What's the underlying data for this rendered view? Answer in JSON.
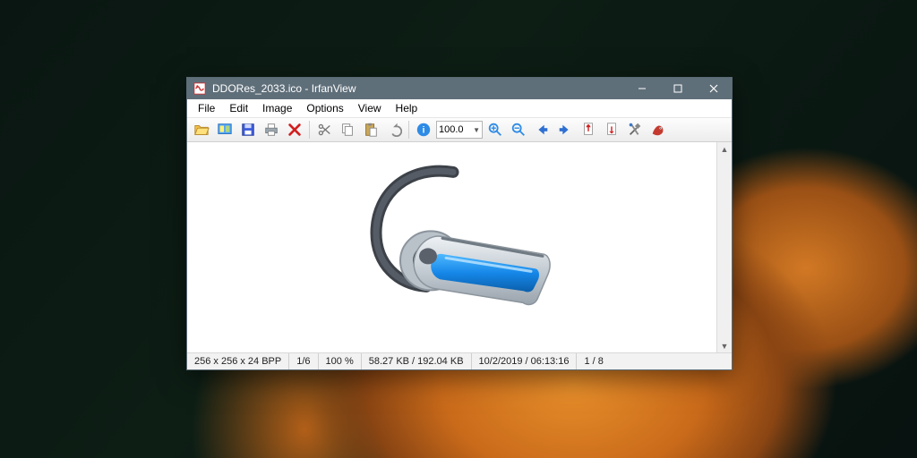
{
  "title": "DDORes_2033.ico - IrfanView",
  "menu": {
    "file": "File",
    "edit": "Edit",
    "image": "Image",
    "options": "Options",
    "view": "View",
    "help": "Help"
  },
  "toolbar": {
    "zoom_value": "100.0"
  },
  "status": {
    "dims": "256 x 256 x 24 BPP",
    "index": "1/6",
    "zoom": "100 %",
    "size": "58.27 KB / 192.04 KB",
    "datetime": "10/2/2019 / 06:13:16",
    "page": "1 / 8"
  },
  "icons": {
    "open": "open-folder-icon",
    "slideshow": "slideshow-icon",
    "save": "save-icon",
    "print": "print-icon",
    "delete": "delete-x-icon",
    "cut": "scissors-icon",
    "copy": "copy-icon",
    "paste": "clipboard-paste-icon",
    "undo": "undo-icon",
    "info": "info-icon",
    "zoom_in": "zoom-in-icon",
    "zoom_out": "zoom-out-icon",
    "prev": "arrow-left-icon",
    "next": "arrow-right-icon",
    "prev_page": "page-prev-icon",
    "next_page": "page-next-icon",
    "settings": "settings-tools-icon",
    "about": "irfanview-logo-icon"
  },
  "colors": {
    "accent_blue": "#1e90ff",
    "titlebar": "#5f6f7a",
    "delete_red": "#d21f1f"
  }
}
